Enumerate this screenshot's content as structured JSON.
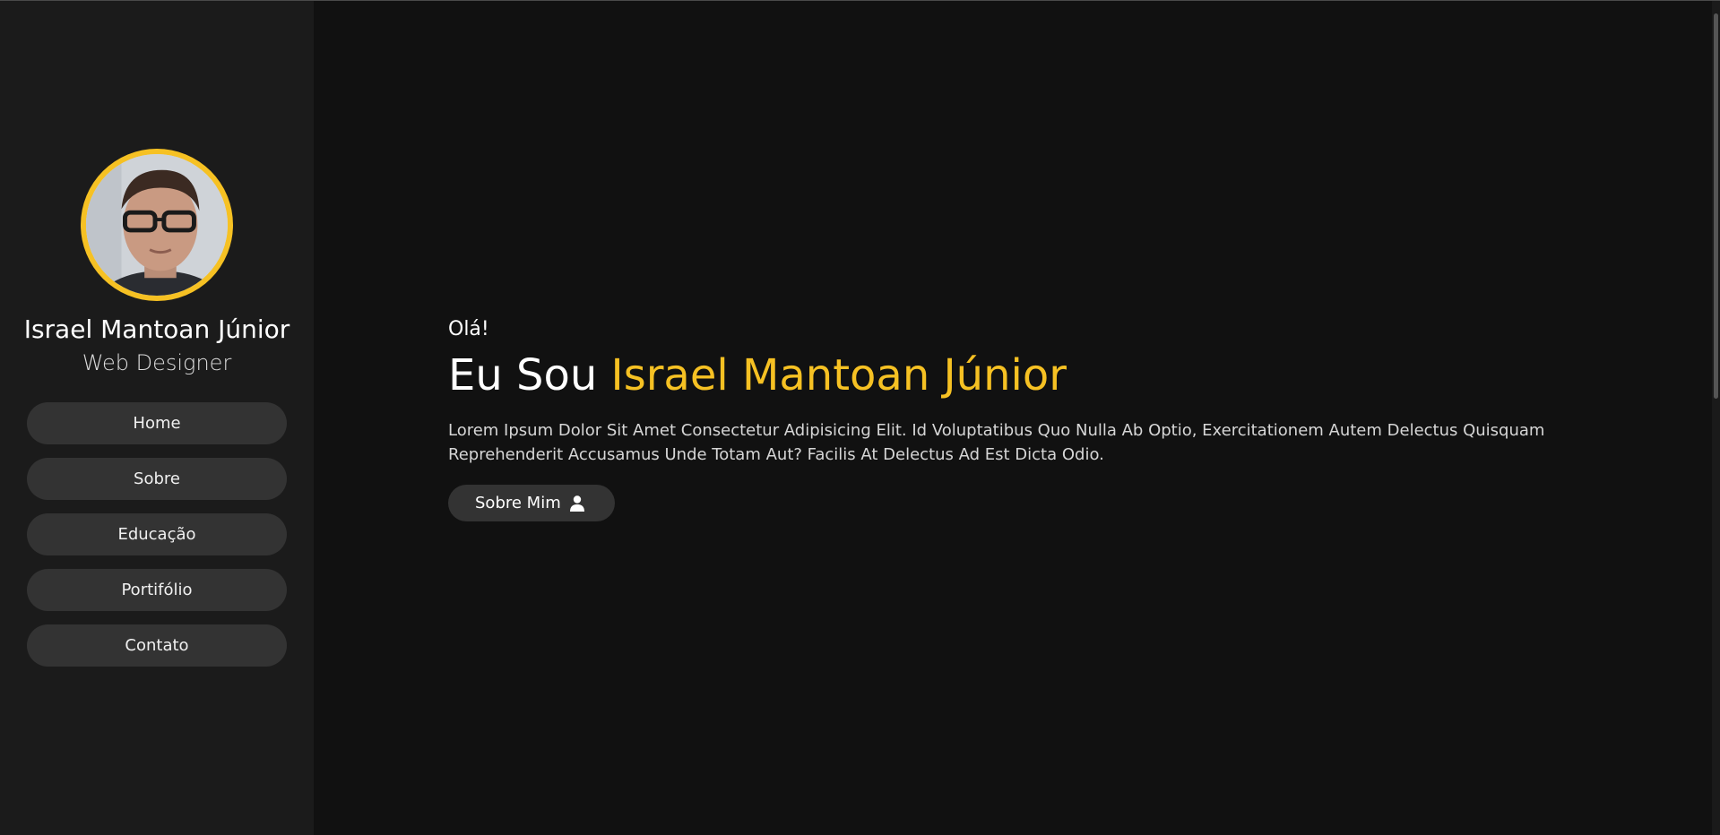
{
  "sidebar": {
    "name": "Israel Mantoan Júnior",
    "role": "Web Designer",
    "nav": [
      {
        "label": "Home"
      },
      {
        "label": "Sobre"
      },
      {
        "label": "Educação"
      },
      {
        "label": "Portifólio"
      },
      {
        "label": "Contato"
      }
    ]
  },
  "hero": {
    "greeting": "Olá!",
    "headline_prefix": "Eu Sou",
    "headline_name": "Israel Mantoan Júnior",
    "description": "Lorem Ipsum Dolor Sit Amet Consectetur Adipisicing Elit. Id Voluptatibus Quo Nulla Ab Optio, Exercitationem Autem Delectus Quisquam Reprehenderit Accusamus Unde Totam Aut? Facilis At Delectus Ad Est Dicta Odio.",
    "button_label": "Sobre Mim",
    "button_icon": "user-icon"
  },
  "colors": {
    "accent": "#f6c123",
    "background": "#111111",
    "sidebar": "#1b1b1b",
    "button": "#333333"
  }
}
